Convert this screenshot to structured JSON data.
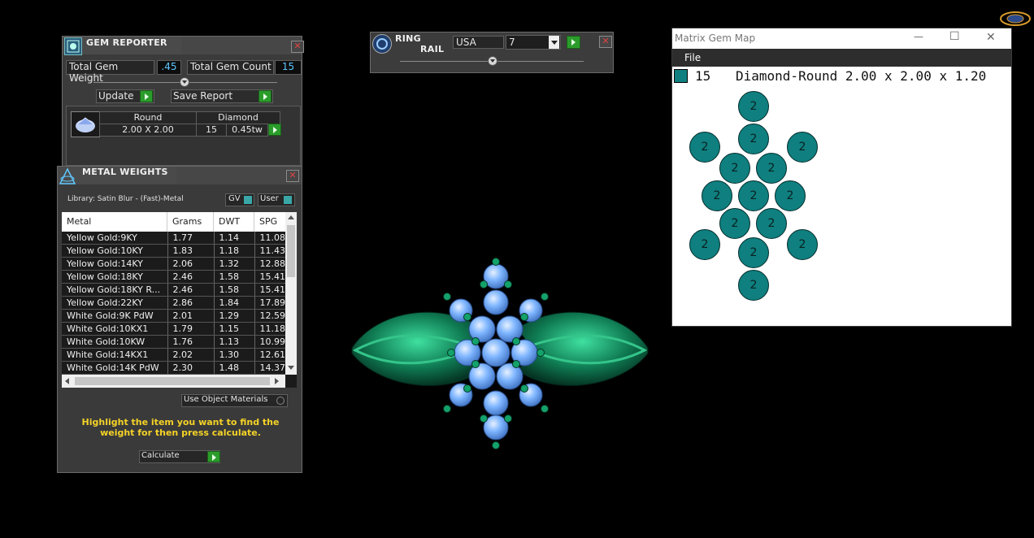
{
  "gem_reporter": {
    "title": "GEM REPORTER",
    "close": "✕",
    "total_weight_label": "Total Gem Weight",
    "total_weight_value": ".45",
    "total_count_label": "Total Gem Count",
    "total_count_value": "15",
    "update_label": "Update",
    "save_report_label": "Save Report",
    "gem": {
      "shape": "Round",
      "size": "2.00 X 2.00",
      "material": "Diamond",
      "count": "15",
      "weight": "0.45tw"
    }
  },
  "metal_weights": {
    "title": "METAL WEIGHTS",
    "close": "✕",
    "library": "Library: Satin Blur - (Fast)-Metal",
    "gv_label": "GV",
    "user_label": "User",
    "columns": [
      "Metal",
      "Grams",
      "DWT",
      "SPG"
    ],
    "rows": [
      [
        "Yellow Gold:9KY",
        "1.77",
        "1.14",
        "11.08"
      ],
      [
        "Yellow Gold:10KY",
        "1.83",
        "1.18",
        "11.43"
      ],
      [
        "Yellow Gold:14KY",
        "2.06",
        "1.32",
        "12.88"
      ],
      [
        "Yellow Gold:18KY",
        "2.46",
        "1.58",
        "15.41"
      ],
      [
        "Yellow Gold:18KY R...",
        "2.46",
        "1.58",
        "15.41"
      ],
      [
        "Yellow Gold:22KY",
        "2.86",
        "1.84",
        "17.89"
      ],
      [
        "White Gold:9K PdW",
        "2.01",
        "1.29",
        "12.59"
      ],
      [
        "White Gold:10KX1",
        "1.79",
        "1.15",
        "11.18"
      ],
      [
        "White Gold:10KW",
        "1.76",
        "1.13",
        "10.99"
      ],
      [
        "White Gold:14KX1",
        "2.02",
        "1.30",
        "12.61"
      ],
      [
        "White Gold:14K PdW",
        "2.30",
        "1.48",
        "14.37"
      ]
    ],
    "use_object_materials": "Use Object Materials",
    "hint": "Highlight the item you want to find the weight for then press calculate.",
    "calculate_label": "Calculate"
  },
  "ring_rail": {
    "title_line1": "RING",
    "title_line2": "RAIL",
    "region": "USA",
    "size": "7",
    "close": "✕"
  },
  "gem_map": {
    "window_title": "Matrix Gem Map",
    "menu_file": "File",
    "minimize": "—",
    "maximize": "☐",
    "close": "✕",
    "count": "15",
    "description": "Diamond-Round 2.00 x 2.00 x 1.20",
    "swatch_color": "#0f7f7f",
    "gem_label": "2"
  },
  "colors": {
    "metal_green": "#0f7a52",
    "stone_blue": "#7fb6ff",
    "accent_green": "#2b9c2b",
    "value_blue": "#5ec7ff",
    "hint_yellow": "#f5d327"
  }
}
